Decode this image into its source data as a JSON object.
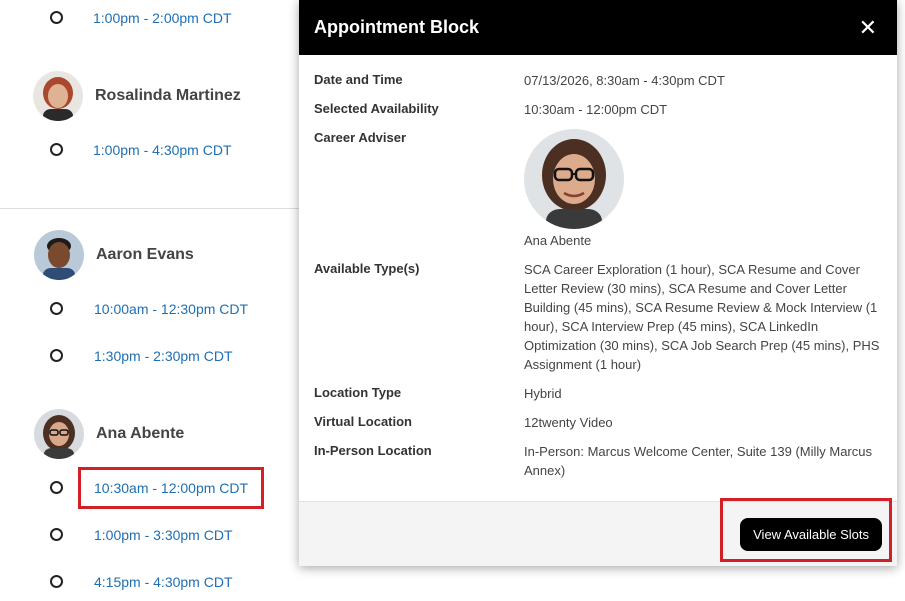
{
  "background": {
    "top_slot": "1:00pm - 2:00pm CDT",
    "advisers": [
      {
        "name": "Rosalinda Martinez",
        "slots": [
          "1:00pm - 4:30pm CDT"
        ]
      },
      {
        "name": "Aaron Evans",
        "slots": [
          "10:00am - 12:30pm CDT",
          "1:30pm - 2:30pm CDT"
        ]
      },
      {
        "name": "Ana Abente",
        "slots": [
          "10:30am - 12:00pm CDT",
          "1:00pm - 3:30pm CDT",
          "4:15pm - 4:30pm CDT"
        ]
      }
    ]
  },
  "modal": {
    "title": "Appointment Block",
    "close_icon": "close-icon",
    "fields": {
      "date_time_label": "Date and Time",
      "date_time_value": "07/13/2026, 8:30am - 4:30pm CDT",
      "selected_label": "Selected Availability",
      "selected_value": "10:30am - 12:00pm CDT",
      "adviser_label": "Career Adviser",
      "adviser_name": "Ana Abente",
      "types_label": "Available Type(s)",
      "types_value": "SCA Career Exploration (1 hour), SCA Resume and Cover Letter Review (30 mins), SCA Resume and Cover Letter Building (45 mins), SCA Resume Review & Mock Interview (1 hour), SCA Interview Prep (45 mins), SCA LinkedIn Optimization (30 mins), SCA Job Search Prep (45 mins), PHS Assignment (1 hour)",
      "location_type_label": "Location Type",
      "location_type_value": "Hybrid",
      "virtual_label": "Virtual Location",
      "virtual_value": "12twenty Video",
      "inperson_label": "In-Person Location",
      "inperson_value": "In-Person: Marcus Welcome Center, Suite 139 (Milly Marcus Annex)"
    },
    "footer": {
      "button_label": "View Available Slots"
    }
  },
  "colors": {
    "link": "#1f6fb2",
    "highlight": "#d32027",
    "header_bg": "#000000"
  }
}
